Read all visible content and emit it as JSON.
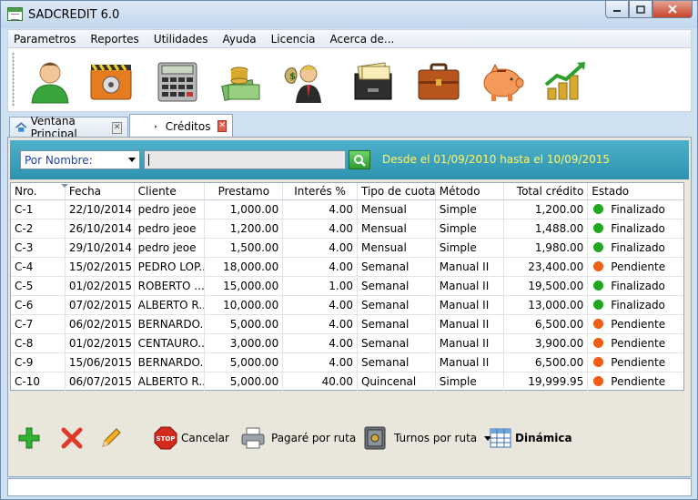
{
  "window": {
    "title": "SADCREDIT 6.0"
  },
  "menu": [
    "Parametros",
    "Reportes",
    "Utilidades",
    "Ayuda",
    "Licencia",
    "Acerca de..."
  ],
  "toolbar_icons": [
    "client-icon",
    "vault-icon",
    "calculator-icon",
    "money-stack-icon",
    "banker-icon",
    "filing-box-icon",
    "briefcase-icon",
    "piggy-bank-icon",
    "growth-chart-icon"
  ],
  "tabs": [
    {
      "label": "Ventana Principal",
      "icon": "home-icon",
      "active": false
    },
    {
      "label": "Créditos",
      "icon": "play-icon",
      "active": true
    }
  ],
  "filter": {
    "combo_value": "Por Nombre:",
    "search_value": "",
    "range_text": "Desde el 01/09/2010 hasta el 10/09/2015"
  },
  "colors": {
    "finalizado": "#1fa81f",
    "pendiente": "#ef5c14",
    "range_text": "#fff56a"
  },
  "table": {
    "columns": [
      "Nro.",
      "Fecha",
      "Cliente",
      "Prestamo",
      "Interés %",
      "Tipo de cuotas",
      "Método",
      "Total crédito",
      "Estado"
    ],
    "rows": [
      [
        "C-1",
        "22/10/2014",
        "pedro jeoe",
        "1,000.00",
        "4.00",
        "Mensual",
        "Simple",
        "1,200.00",
        "Finalizado"
      ],
      [
        "C-2",
        "26/10/2014",
        "pedro jeoe",
        "1,200.00",
        "4.00",
        "Mensual",
        "Simple",
        "1,488.00",
        "Finalizado"
      ],
      [
        "C-3",
        "29/10/2014",
        "pedro jeoe",
        "1,500.00",
        "4.00",
        "Mensual",
        "Simple",
        "1,980.00",
        "Finalizado"
      ],
      [
        "C-4",
        "15/02/2015",
        "PEDRO LOP...",
        "18,000.00",
        "4.00",
        "Semanal",
        "Manual II",
        "23,400.00",
        "Pendiente"
      ],
      [
        "C-5",
        "01/02/2015",
        "ROBERTO ...",
        "15,000.00",
        "1.00",
        "Semanal",
        "Manual II",
        "19,500.00",
        "Finalizado"
      ],
      [
        "C-6",
        "07/02/2015",
        "ALBERTO R...",
        "10,000.00",
        "4.00",
        "Semanal",
        "Manual II",
        "13,000.00",
        "Finalizado"
      ],
      [
        "C-7",
        "06/02/2015",
        "BERNARDO...",
        "5,000.00",
        "4.00",
        "Semanal",
        "Manual II",
        "6,500.00",
        "Pendiente"
      ],
      [
        "C-8",
        "01/02/2015",
        "CENTAURO...",
        "3,000.00",
        "4.00",
        "Semanal",
        "Manual II",
        "3,900.00",
        "Pendiente"
      ],
      [
        "C-9",
        "15/06/2015",
        "BERNARDO...",
        "5,000.00",
        "4.00",
        "Semanal",
        "Manual II",
        "6,500.00",
        "Pendiente"
      ],
      [
        "C-10",
        "06/07/2015",
        "ALBERTO R...",
        "5,000.00",
        "40.00",
        "Quincenal",
        "Simple",
        "19,999.95",
        "Pendiente"
      ]
    ]
  },
  "actions": {
    "cancel_label": "Cancelar",
    "pagare_label": "Pagaré por ruta",
    "turnos_label": "Turnos por ruta",
    "dinamica_label": "Dinámica"
  }
}
